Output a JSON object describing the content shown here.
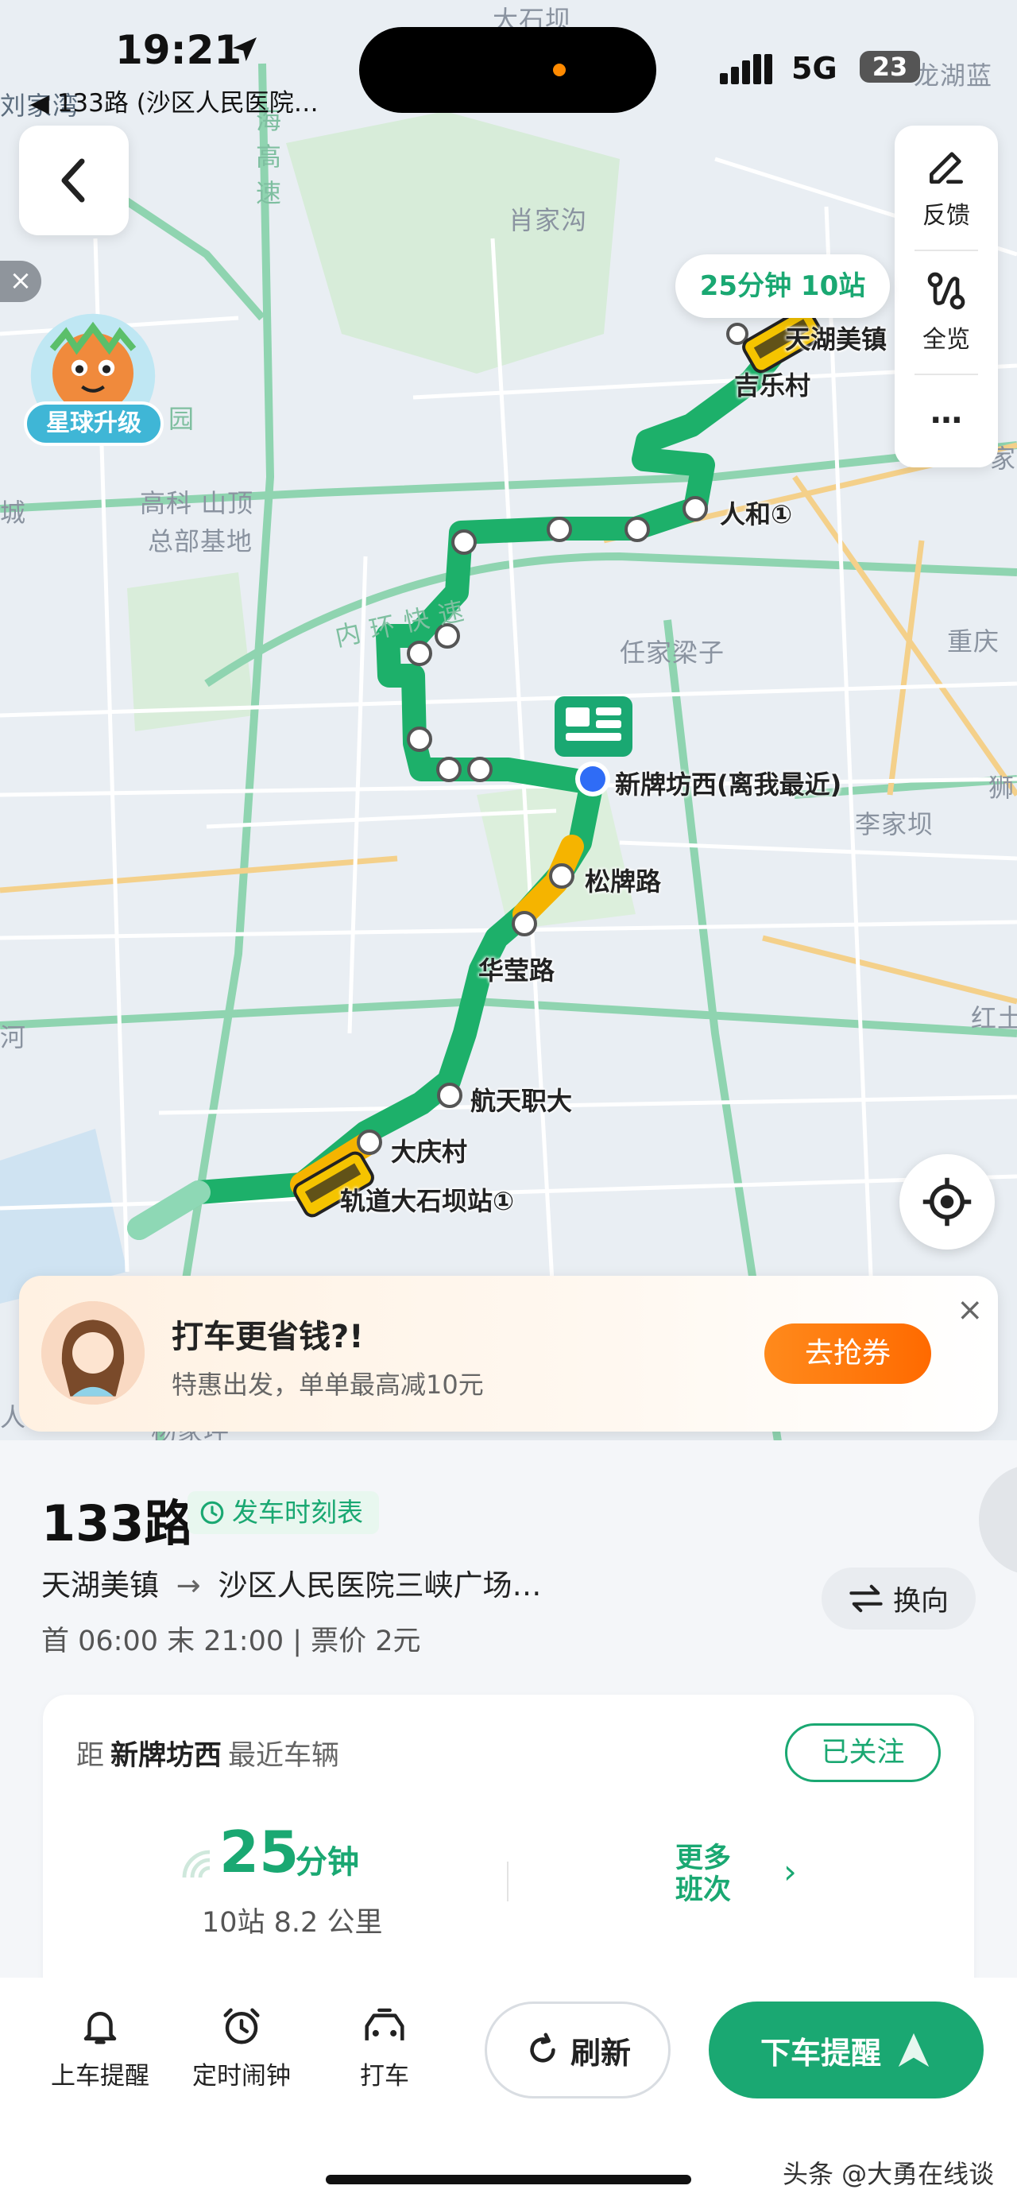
{
  "status": {
    "time": "19:21",
    "back_context": "◀ 133路 (沙区人民医院…",
    "network": "5G",
    "battery": "23"
  },
  "map": {
    "labels": [
      "大石坝",
      "刘家湾",
      "海",
      "高",
      "速",
      "肖家沟",
      "龙湖蓝",
      "园",
      "高科 山顶",
      "总部基地",
      "城",
      "家",
      "内 环 快 速",
      "任家梁子",
      "重庆",
      "李家坝",
      "狮",
      "红土",
      "河",
      "人",
      "杨家坪"
    ],
    "stops": [
      {
        "name": "天湖美镇"
      },
      {
        "name": "吉乐村"
      },
      {
        "name": "人和①"
      },
      {
        "name": "新牌坊西(离我最近)"
      },
      {
        "name": "松牌路"
      },
      {
        "name": "华莹路"
      },
      {
        "name": "航天职大"
      },
      {
        "name": "大庆村"
      },
      {
        "name": "轨道大石坝站①"
      }
    ],
    "eta_bubble": "25分钟 10站",
    "line_color": "#1db06a",
    "congestion_color": "#f5b400"
  },
  "toolbar": {
    "feedback": "反馈",
    "overview": "全览",
    "more": "…"
  },
  "planet": {
    "badge": "星球升级",
    "close": "×"
  },
  "promo": {
    "title": "打车更省钱?!",
    "subtitle": "特惠出发，单单最高减10元",
    "button": "去抢券",
    "close": "×"
  },
  "route": {
    "name": "133路",
    "timetable": "发车时刻表",
    "from": "天湖美镇",
    "arrow": "→",
    "to": "沙区人民医院三峡广场…",
    "meta": "首 06:00 末 21:00 | 票价 2元",
    "swap": "换向"
  },
  "card": {
    "prefix": "距",
    "station": "新牌坊西",
    "suffix": "最近车辆",
    "follow": "已关注",
    "eta_minutes": "25",
    "eta_unit": "分钟",
    "eta_detail": "10站   8.2 公里",
    "more_trips_line1": "更多",
    "more_trips_line2": "班次"
  },
  "bottom": {
    "boarding": "上车提醒",
    "alarm": "定时闹钟",
    "taxi": "打车",
    "refresh": "刷新",
    "alight": "下车提醒"
  },
  "watermark": "头条 @大勇在线谈",
  "colors": {
    "accent": "#1aa872",
    "promo_button": "#ff7a10",
    "current_stop": "#2f6cf6"
  }
}
